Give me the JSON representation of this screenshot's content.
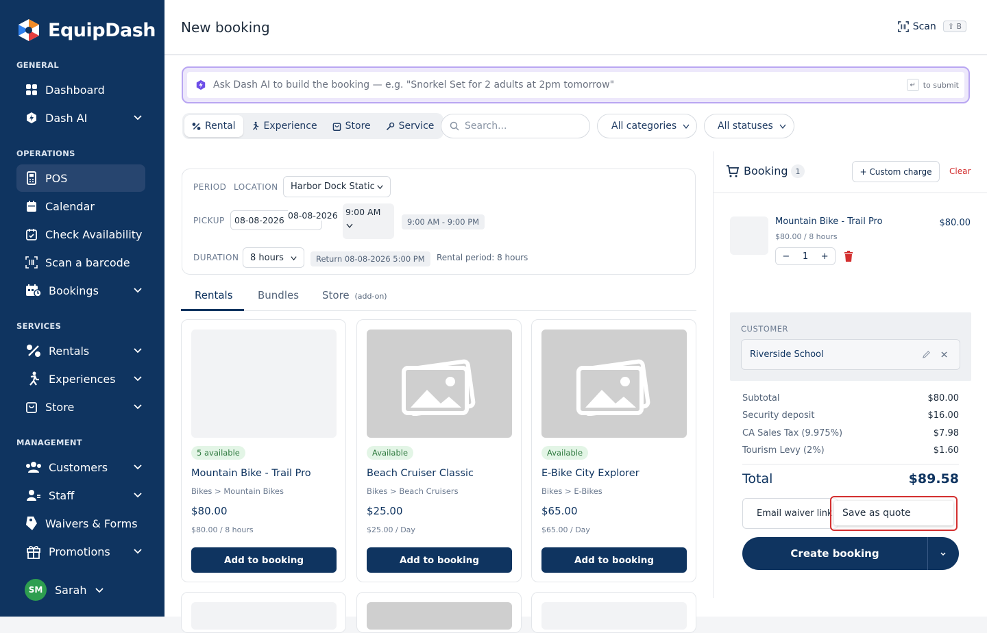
{
  "app": {
    "name": "EquipDash"
  },
  "sidebar": {
    "sections": [
      {
        "title": "GENERAL"
      },
      {
        "title": "OPERATIONS"
      },
      {
        "title": "SERVICES"
      },
      {
        "title": "MANAGEMENT"
      }
    ],
    "items": [
      {
        "label": "Dashboard",
        "icon": "grid-icon"
      },
      {
        "label": "Dash AI",
        "icon": "ai-shield-icon"
      },
      {
        "label": "POS",
        "icon": "pos-terminal-icon"
      },
      {
        "label": "Calendar",
        "icon": "calendar-icon"
      },
      {
        "label": "Check Availability",
        "icon": "calendar-check-icon"
      },
      {
        "label": "Scan a barcode",
        "icon": "barcode-icon"
      },
      {
        "label": "Bookings",
        "icon": "bookings-icon"
      },
      {
        "label": "Rentals",
        "icon": "rentals-icon"
      },
      {
        "label": "Experiences",
        "icon": "experiences-icon"
      },
      {
        "label": "Store",
        "icon": "store-bag-icon"
      },
      {
        "label": "Customers",
        "icon": "customers-icon"
      },
      {
        "label": "Staff",
        "icon": "staff-icon"
      },
      {
        "label": "Waivers & Forms",
        "icon": "tag-icon"
      },
      {
        "label": "Promotions",
        "icon": "gift-icon"
      }
    ],
    "user": {
      "initials": "SM",
      "name": "Sarah"
    }
  },
  "header": {
    "title": "New booking",
    "scan_label": "Scan",
    "scan_shortcut": "⇧ B"
  },
  "ai_bar": {
    "placeholder": "Ask Dash AI to build the booking — e.g. \"Snorkel Set for 2 adults at 2pm tomorrow\"",
    "hint": "to submit",
    "hint_key": "↵"
  },
  "type_tabs": [
    {
      "label": "Rental",
      "selected": true
    },
    {
      "label": "Experience"
    },
    {
      "label": "Store"
    },
    {
      "label": "Service"
    }
  ],
  "filters": {
    "search_placeholder": "Search...",
    "category": "All categories",
    "status": "All statuses"
  },
  "period": {
    "period_label": "PERIOD",
    "location_label": "LOCATION",
    "location": "Harbor Dock Static",
    "pickup_label": "PICKUP",
    "pickup_date": "08-08-2026",
    "pickup_date2": "08-08-2026",
    "pickup_time": "9:00 AM",
    "hours": "9:00 AM - 9:00 PM",
    "duration_label": "DURATION",
    "duration": "8 hours",
    "return_info": "Return 08-08-2026 5:00 PM",
    "rental_period": "Rental period: 8 hours"
  },
  "content_tabs": [
    {
      "label": "Rentals"
    },
    {
      "label": "Bundles"
    },
    {
      "label": "Store",
      "suffix": "(add-on)"
    }
  ],
  "products": [
    {
      "badge": "5 available",
      "name": "Mountain Bike - Trail Pro",
      "category": "Bikes > Mountain Bikes",
      "price": "$80.00",
      "sub": "$80.00 / 8 hours",
      "button": "Add to booking"
    },
    {
      "badge": "Available",
      "name": "Beach Cruiser Classic",
      "category": "Bikes > Beach Cruisers",
      "price": "$25.00",
      "sub": "$25.00 / Day",
      "button": "Add to booking"
    },
    {
      "badge": "Available",
      "name": "E-Bike City Explorer",
      "category": "Bikes > E-Bikes",
      "price": "$65.00",
      "sub": "$65.00 / Day",
      "button": "Add to booking"
    }
  ],
  "booking": {
    "title": "Booking",
    "count": "1",
    "custom_charge": "+ Custom charge",
    "clear": "Clear",
    "item": {
      "name": "Mountain Bike - Trail Pro",
      "price": "$80.00",
      "sub": "$80.00 / 8 hours",
      "qty": "1",
      "minus": "−",
      "plus": "+"
    },
    "customer_label": "CUSTOMER",
    "customer": "Riverside School",
    "subtotal_label": "Subtotal",
    "subtotal": "$80.00",
    "deposit_label": "Security deposit",
    "deposit": "$16.00",
    "tax_label": "CA Sales Tax (9.975%)",
    "tax": "$7.98",
    "levy_label": "Tourism Levy (2%)",
    "levy": "$1.60",
    "total_label": "Total",
    "total": "$89.58",
    "email_waiver": "Email waiver link",
    "save_quote": "Save as quote",
    "create": "Create booking"
  },
  "colors": {
    "navy": "#0f3460",
    "accent_red": "#d32f2f",
    "ai_purple": "#6d4ee8",
    "green": "#2e9e4f"
  }
}
